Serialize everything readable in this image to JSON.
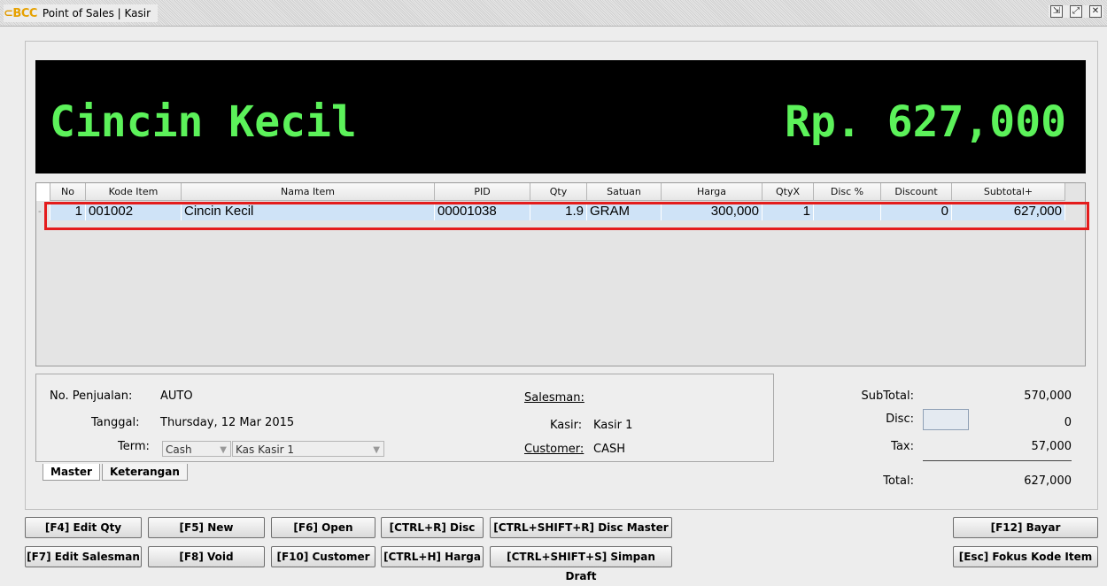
{
  "window": {
    "logo": "BCC",
    "title": "Point of Sales | Kasir",
    "buttons": [
      "restore",
      "maximize",
      "close"
    ]
  },
  "display": {
    "item_name": "Cincin Kecil",
    "total": "Rp. 627,000"
  },
  "grid": {
    "columns": [
      "No",
      "Kode Item",
      "Nama Item",
      "PID",
      "Qty",
      "Satuan",
      "Harga",
      "QtyX",
      "Disc %",
      "Discount",
      "Subtotal+"
    ],
    "rows": [
      {
        "no": "1",
        "kode": "001002",
        "nama": "Cincin Kecil",
        "pid": "00001038",
        "qty": "1.9",
        "satuan": "GRAM",
        "harga": "300,000",
        "qtyx": "1",
        "disc_pct": "",
        "discount": "0",
        "subtotal": "627,000"
      }
    ]
  },
  "master": {
    "no_penjualan_label": "No. Penjualan:",
    "no_penjualan_value": "AUTO",
    "tanggal_label": "Tanggal:",
    "tanggal_value": "Thursday, 12 Mar 2015",
    "term_label": "Term:",
    "term_value": "Cash",
    "kas_value": "Kas Kasir 1",
    "salesman_label": "Salesman:",
    "kasir_label": "Kasir:",
    "kasir_value": "Kasir 1",
    "customer_label": "Customer:",
    "customer_value": "CASH"
  },
  "tabs": [
    "Master",
    "Keterangan"
  ],
  "totals": {
    "subtotal_label": "SubTotal:",
    "subtotal_value": "570,000",
    "disc_label": "Disc:",
    "disc_value": "0",
    "tax_label": "Tax:",
    "tax_value": "57,000",
    "total_label": "Total:",
    "total_value": "627,000"
  },
  "buttons": {
    "edit_qty": "[F4] Edit Qty",
    "new": "[F5] New",
    "open": "[F6] Open",
    "disc": "[CTRL+R] Disc",
    "disc_master": "[CTRL+SHIFT+R] Disc Master",
    "bayar": "[F12] Bayar",
    "edit_salesman": "[F7] Edit Salesman",
    "void": "[F8] Void",
    "customer": "[F10] Customer",
    "harga": "[CTRL+H] Harga",
    "simpan_draft": "[CTRL+SHIFT+S] Simpan Draft",
    "fokus": "[Esc] Fokus Kode Item"
  },
  "colors": {
    "display_bg": "#000000",
    "display_text": "#5cf25a",
    "selected_row": "#cfe3f7",
    "highlight_outline": "#e41c1c"
  }
}
